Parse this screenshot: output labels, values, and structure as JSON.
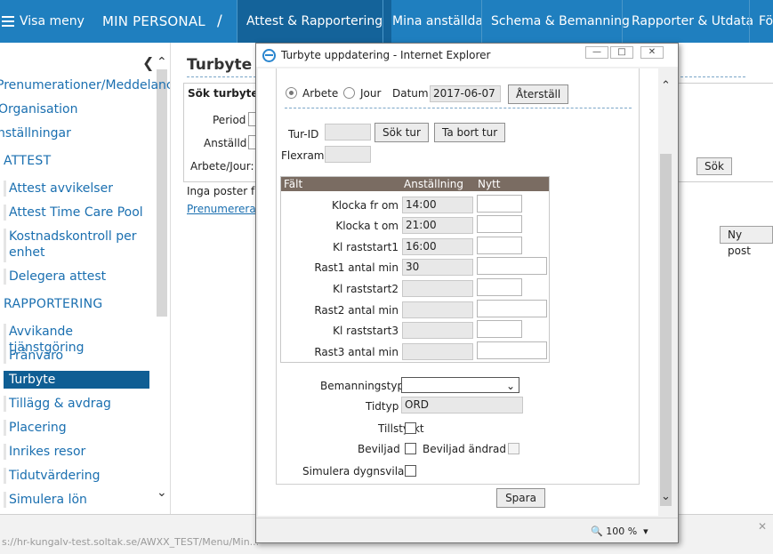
{
  "topbar": {
    "menu_label": "Visa meny",
    "brand": "MIN PERSONAL",
    "separator": "/",
    "tabs": [
      {
        "label": "Attest & Rapportering",
        "active": true
      },
      {
        "label": "Mina anställda",
        "active": false
      },
      {
        "label": "Schema & Bemanning",
        "active": false
      },
      {
        "label": "Rapporter & Utdata",
        "active": false
      },
      {
        "label": "Fö",
        "active": false
      }
    ]
  },
  "sidebar": {
    "links": [
      "Prenumerationer/Meddelanc",
      "Organisation",
      "nställningar"
    ],
    "attest": {
      "heading": "ATTEST",
      "items": [
        "Attest avvikelser",
        "Attest Time Care Pool",
        "Kostnadskontroll per",
        "enhet",
        "Delegera attest"
      ]
    },
    "rapportering": {
      "heading": "RAPPORTERING",
      "items": [
        "Avvikande tjänstgöring",
        "Frånvaro",
        "Turbyte",
        "Tillägg & avdrag",
        "Placering",
        "Inrikes resor",
        "Tidutvärdering",
        "Simulera lön"
      ]
    }
  },
  "main": {
    "title": "Turbyte",
    "search_legend": "Sök turbyte",
    "period_label": "Period",
    "anstalld_label": "Anställd",
    "arbete_jour_label": "Arbete/Jour:",
    "search_button": "Sök",
    "new_button": "Ny post",
    "no_records": "Inga poster fu",
    "subscribe_link": "Prenumerera"
  },
  "statusbar": {
    "url": "s://hr-kungalv-test.soltak.se/AWXX_TEST/Menu/Min..."
  },
  "popup": {
    "title": "Turbyte uppdatering - Internet Explorer",
    "radio_arbete": "Arbete",
    "radio_jour": "Jour",
    "datum_label": "Datum",
    "datum_value": "2017-06-07",
    "reset_button": "Återställ",
    "tur_id_label": "Tur-ID",
    "tur_id_value": "",
    "search_tur_button": "Sök tur",
    "delete_tur_button": "Ta bort tur",
    "flexram_label": "Flexram",
    "flexram_value": "",
    "grid": {
      "headers": [
        "Fält",
        "Anställning",
        "Nytt"
      ],
      "rows": [
        {
          "label": "Klocka fr om",
          "anstallning": "14:00",
          "nytt": ""
        },
        {
          "label": "Klocka t om",
          "anstallning": "21:00",
          "nytt": ""
        },
        {
          "label": "Kl raststart1",
          "anstallning": "16:00",
          "nytt": ""
        },
        {
          "label": "Rast1 antal min",
          "anstallning": "30",
          "nytt": ""
        },
        {
          "label": "Kl raststart2",
          "anstallning": "",
          "nytt": ""
        },
        {
          "label": "Rast2 antal min",
          "anstallning": "",
          "nytt": ""
        },
        {
          "label": "Kl raststart3",
          "anstallning": "",
          "nytt": ""
        },
        {
          "label": "Rast3 antal min",
          "anstallning": "",
          "nytt": ""
        }
      ]
    },
    "bemanningstyp_label": "Bemanningstyp",
    "bemanningstyp_value": "",
    "tidtyp_label": "Tidtyp",
    "tidtyp_value": "ORD",
    "tillstyrkt_label": "Tillstyrkt",
    "beviljad_label": "Beviljad",
    "beviljad_andrad_label": "Beviljad ändrad",
    "simulera_label": "Simulera dygnsvila",
    "save_button": "Spara",
    "zoom": "100 %"
  }
}
